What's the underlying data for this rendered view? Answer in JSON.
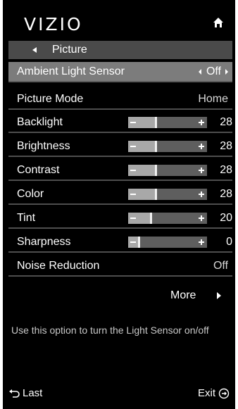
{
  "header": {
    "logo": "VIZIO",
    "home_icon": "home-icon"
  },
  "breadcrumb": {
    "label": "Picture",
    "back_icon": "left-arrow-icon"
  },
  "menu": {
    "ambient_light_sensor": {
      "label": "Ambient Light Sensor",
      "value": "Off"
    },
    "picture_mode": {
      "label": "Picture Mode",
      "value": "Home"
    },
    "backlight": {
      "label": "Backlight",
      "value": "28",
      "level": 0.28
    },
    "brightness": {
      "label": "Brightness",
      "value": "28",
      "level": 0.28
    },
    "contrast": {
      "label": "Contrast",
      "value": "28",
      "level": 0.28
    },
    "color": {
      "label": "Color",
      "value": "28",
      "level": 0.28
    },
    "tint": {
      "label": "Tint",
      "value": "20",
      "level": 0.2
    },
    "sharpness": {
      "label": "Sharpness",
      "value": "0",
      "level": 0.0
    },
    "noise_reduction": {
      "label": "Noise Reduction",
      "value": "Off"
    }
  },
  "more": {
    "label": "More",
    "arrow_icon": "right-arrow-icon"
  },
  "help_text": "Use this option to turn the Light Sensor on/off",
  "footer": {
    "last_label": "Last",
    "exit_label": "Exit"
  },
  "colors": {
    "background": "#000000",
    "selected_row": "#7c7c7c",
    "breadcrumb_bar": "#4a4a4a"
  }
}
